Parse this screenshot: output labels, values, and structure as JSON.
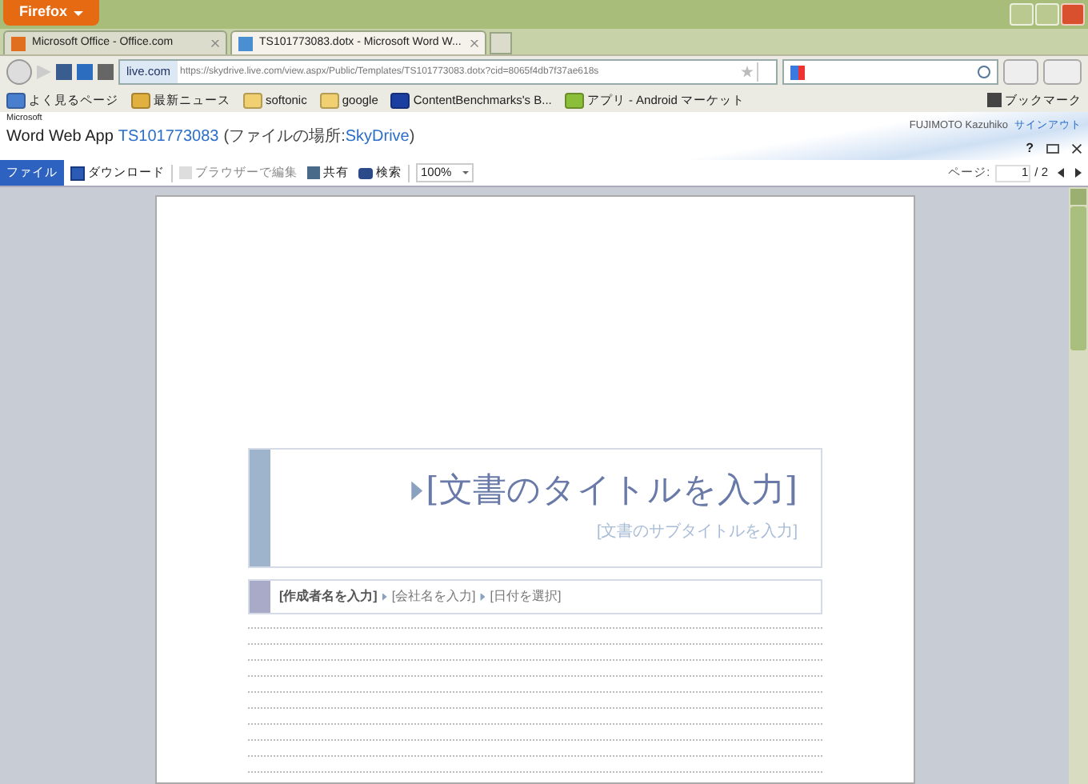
{
  "browser": {
    "menu_button": "Firefox"
  },
  "tabs": [
    {
      "title": "Microsoft Office - Office.com",
      "selected": false
    },
    {
      "title": "TS101773083.dotx - Microsoft Word W...",
      "selected": true
    }
  ],
  "nav": {
    "site": "live.com",
    "url": "https://skydrive.live.com/view.aspx/Public/Templates/TS101773083.dotx?cid=8065f4db7f37ae618s"
  },
  "bookmarks": [
    {
      "label": "よく見るページ",
      "kind": "page"
    },
    {
      "label": "最新ニュース",
      "kind": "feed"
    },
    {
      "label": "softonic",
      "kind": "folder"
    },
    {
      "label": "google",
      "kind": "folder"
    },
    {
      "label": "ContentBenchmarks's B...",
      "kind": "site"
    },
    {
      "label": "アプリ - Android マーケット",
      "kind": "android"
    }
  ],
  "bookmarks_menu": "ブックマーク",
  "app": {
    "brand_small": "Microsoft",
    "brand": "Word Web App",
    "doc_name": "TS101773083",
    "location_prefix": "(ファイルの場所: ",
    "location": "SkyDrive",
    "location_suffix": ")",
    "user": "FUJIMOTO Kazuhiko",
    "sign_out": "サインアウト",
    "help": "?"
  },
  "toolbar": {
    "file_tab": "ファイル",
    "download": "ダウンロード",
    "edit": "ブラウザーで編集",
    "share": "共有",
    "find": "検索",
    "zoom": "100%",
    "page_label": "ページ:",
    "page": "1",
    "page_total": "/ 2"
  },
  "document": {
    "title": "[文書のタイトルを入力]",
    "subtitle": "[文書のサブタイトルを入力]",
    "author": "[作成者名を入力]",
    "company": "[会社名を入力]",
    "date": "[日付を選択]"
  }
}
